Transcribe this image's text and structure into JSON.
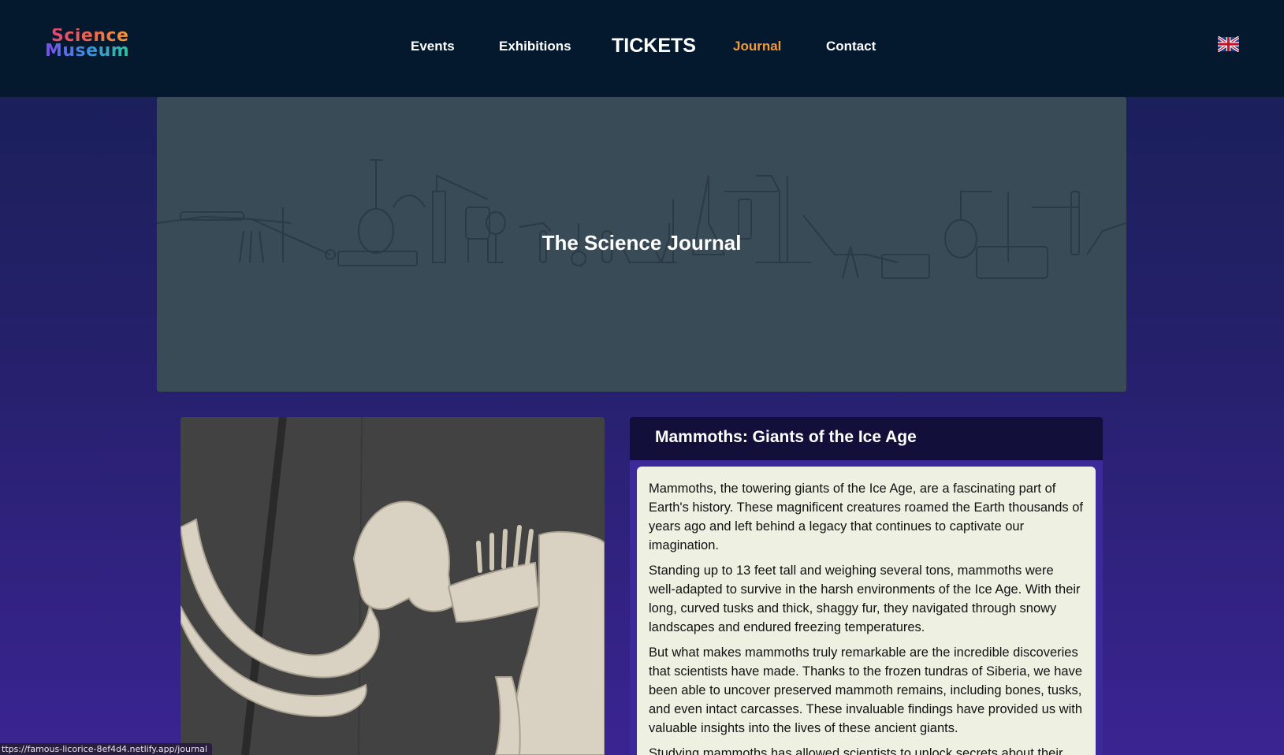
{
  "header": {
    "logo": {
      "line1": "Science",
      "line2": "Museum"
    },
    "nav": [
      {
        "label": "Events"
      },
      {
        "label": "Exhibitions"
      },
      {
        "label": "TICKETS"
      },
      {
        "label": "Journal",
        "active": true
      },
      {
        "label": "Contact"
      }
    ],
    "language_icon": "uk-flag-icon"
  },
  "hero": {
    "title": "The Science Journal"
  },
  "article": {
    "image_icon": "mammoth-skeleton-photo",
    "title": "Mammoths: Giants of the Ice Age",
    "paragraphs": [
      "Mammoths, the towering giants of the Ice Age, are a fascinating part of Earth's history. These magnificent creatures roamed the Earth thousands of years ago and left behind a legacy that continues to captivate our imagination.",
      "Standing up to 13 feet tall and weighing several tons, mammoths were well-adapted to survive in the harsh environments of the Ice Age. With their long, curved tusks and thick, shaggy fur, they navigated through snowy landscapes and endured freezing temperatures.",
      "But what makes mammoths truly remarkable are the incredible discoveries that scientists have made. Thanks to the frozen tundras of Siberia, we have been able to uncover preserved mammoth remains, including bones, tusks, and even intact carcasses. These invaluable findings have provided us with valuable insights into the lives of these ancient giants.",
      "Studying mammoths has allowed scientists to unlock secrets about their"
    ]
  },
  "status_url": "ttps://famous-licorice-8ef4d4.netlify.app/journal",
  "colors": {
    "topbar": "#04182e",
    "active_nav": "#f39a3a",
    "hero_bg": "#394b57",
    "article_head": "#120f3a",
    "article_body": "#eef0e2"
  }
}
